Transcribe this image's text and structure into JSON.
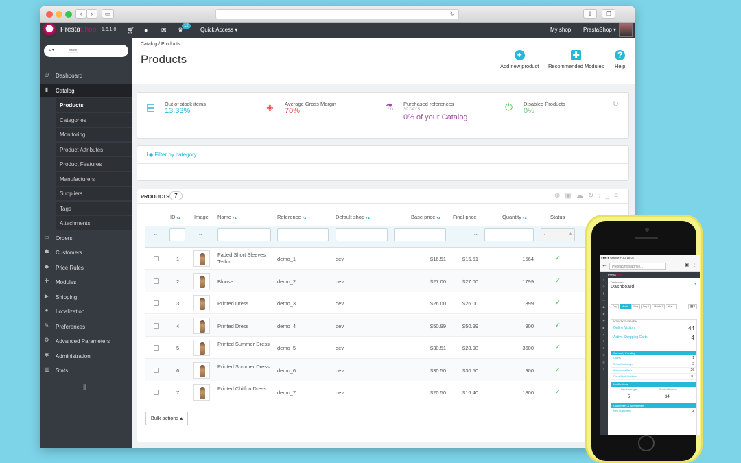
{
  "colors": {
    "accent": "#25b9d7",
    "brand": "#df0067",
    "red": "#e84e4e",
    "purple": "#a14ba8",
    "green": "#72c279",
    "topbar": "#363a41"
  },
  "topbar": {
    "brand_pre": "Presta",
    "brand_post": "Shop",
    "version": "1.6.1.0",
    "badge": "12",
    "quick_access": "Quick Access ▾",
    "my_shop": "My shop",
    "user": "PrestaShop ▾"
  },
  "sidebar": {
    "search_placeholder": "Search",
    "items": [
      {
        "label": "Dashboard",
        "icon": "dashboard-icon",
        "glyph": "◎"
      },
      {
        "label": "Catalog",
        "icon": "book-icon",
        "glyph": "▮"
      },
      {
        "label": "Orders",
        "icon": "credit-card-icon",
        "glyph": "▭"
      },
      {
        "label": "Customers",
        "icon": "users-icon",
        "glyph": "☗"
      },
      {
        "label": "Price Rules",
        "icon": "tag-icon",
        "glyph": "◆"
      },
      {
        "label": "Modules",
        "icon": "puzzle-icon",
        "glyph": "✚"
      },
      {
        "label": "Shipping",
        "icon": "truck-icon",
        "glyph": "▶"
      },
      {
        "label": "Localization",
        "icon": "globe-icon",
        "glyph": "●"
      },
      {
        "label": "Preferences",
        "icon": "wrench-icon",
        "glyph": "✎"
      },
      {
        "label": "Advanced Parameters",
        "icon": "cogs-icon",
        "glyph": "⚙"
      },
      {
        "label": "Administration",
        "icon": "cog-icon",
        "glyph": "✱"
      },
      {
        "label": "Stats",
        "icon": "bar-chart-icon",
        "glyph": "▥"
      }
    ],
    "catalog_sub": [
      "Products",
      "Categories",
      "Monitoring",
      "Product Attributes",
      "Product Features",
      "Manufacturers",
      "Suppliers",
      "Tags",
      "Attachments"
    ]
  },
  "header": {
    "breadcrumb": "Catalog  /  Products",
    "title": "Products",
    "add_label": "Add new product",
    "modules_label": "Recommended Modules",
    "help_label": "Help"
  },
  "kpis": [
    {
      "label": "Out of stock items",
      "sub": "",
      "value": "13.33%",
      "icon": "archive-icon",
      "glyph": "▤",
      "color": "#25b9d7"
    },
    {
      "label": "Average Gross Margin",
      "sub": "",
      "value": "70%",
      "icon": "tags-icon",
      "glyph": "◈",
      "color": "#e84e4e"
    },
    {
      "label": "Purchased references",
      "sub": "30 DAYS",
      "value": "0% of your Catalog",
      "icon": "flask-icon",
      "glyph": "⚗",
      "color": "#a14ba8"
    },
    {
      "label": "Disabled Products",
      "sub": "",
      "value": "0%",
      "icon": "power-icon",
      "glyph": "⏻",
      "color": "#72c279"
    }
  ],
  "filter": {
    "label": "Filter by category"
  },
  "products": {
    "header_label": "PRODUCTS",
    "count": "7",
    "columns": [
      "ID",
      "Image",
      "Name",
      "Reference",
      "Default shop",
      "Base price",
      "Final price",
      "Quantity",
      "Status"
    ],
    "filter_dash": "--",
    "status_select": "-",
    "rows": [
      {
        "id": "1",
        "name": "Faded Short Sleeves T-shirt",
        "ref": "demo_1",
        "shop": "dev",
        "base": "$16.51",
        "final": "$16.51",
        "qty": "1564"
      },
      {
        "id": "2",
        "name": "Blouse",
        "ref": "demo_2",
        "shop": "dev",
        "base": "$27.00",
        "final": "$27.00",
        "qty": "1799"
      },
      {
        "id": "3",
        "name": "Printed Dress",
        "ref": "demo_3",
        "shop": "dev",
        "base": "$26.00",
        "final": "$26.00",
        "qty": "899"
      },
      {
        "id": "4",
        "name": "Printed Dress",
        "ref": "demo_4",
        "shop": "dev",
        "base": "$50.99",
        "final": "$50.99",
        "qty": "900"
      },
      {
        "id": "5",
        "name": "Printed Summer Dress",
        "ref": "demo_5",
        "shop": "dev",
        "base": "$30.51",
        "final": "$28.98",
        "qty": "3600"
      },
      {
        "id": "6",
        "name": "Printed Summer Dress",
        "ref": "demo_6",
        "shop": "dev",
        "base": "$30.50",
        "final": "$30.50",
        "qty": "900"
      },
      {
        "id": "7",
        "name": "Printed Chiffon Dress",
        "ref": "demo_7",
        "shop": "dev",
        "base": "$20.50",
        "final": "$16.40",
        "qty": "1800"
      }
    ],
    "bulk_label": "Bulk actions ▴"
  },
  "phone": {
    "status": "●●●●● Orange F  3G            16:03",
    "url": "PrestaShop/admin...",
    "dash_crumb": "Dashboard",
    "dash_title": "Dashboard",
    "tabs": [
      "Day",
      "Month",
      "Year",
      "Day-1",
      "Month-1",
      "Year-1"
    ],
    "activity": "ACTIVITY OVERVIEW",
    "online_label": "Online Visitors",
    "online_value": "44",
    "carts_label": "Active Shopping Carts",
    "carts_value": "4",
    "pending": "Currently Pending",
    "pending_rows": [
      {
        "label": "Orders",
        "value": "1"
      },
      {
        "label": "Return/Exchanges",
        "value": "2"
      },
      {
        "label": "Abandoned Carts",
        "value": "26"
      },
      {
        "label": "Out of Stock Products",
        "value": "10"
      }
    ],
    "notifications": "Notifications",
    "msg_label": "New Messages",
    "msg_value": "5",
    "review_label": "Product Review",
    "review_value": "34",
    "newsletter": "Customers & Newsletters",
    "new_customers": "New Customers",
    "new_customers_value": "2"
  }
}
